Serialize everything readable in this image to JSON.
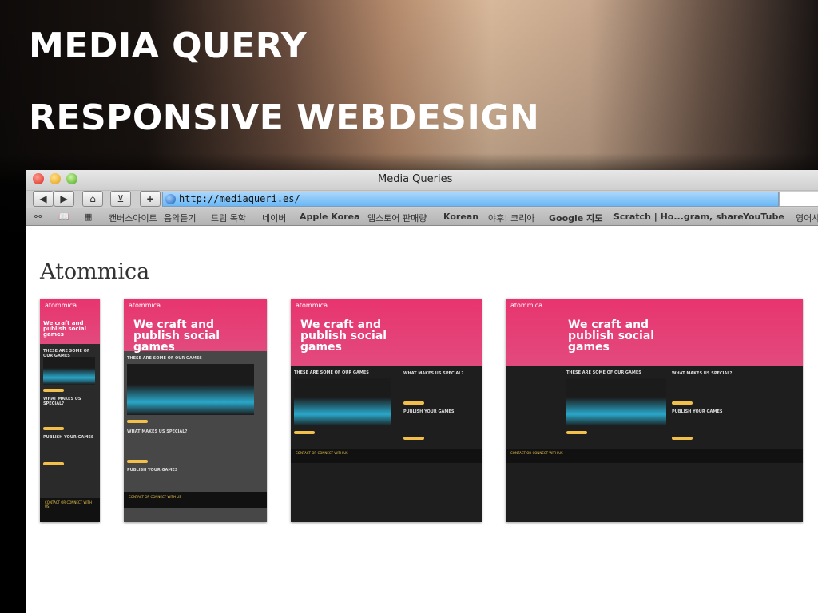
{
  "slide": {
    "title1": "MEDIA QUERY",
    "title2": "RESPONSIVE WEBDESIGN"
  },
  "browser": {
    "window_title": "Media Queries",
    "url": "http://mediaqueri.es/",
    "home_label": "⌂",
    "add_label": "+",
    "bookmarks": [
      "캔버스아이트",
      "음악듣기",
      "드럼 독학",
      "네이버",
      "Apple Korea",
      "앱스토어 판매량",
      "Korean",
      "야후! 코리아",
      "Google 지도",
      "Scratch | Ho...gram, share",
      "YouTube",
      "영어사"
    ]
  },
  "page": {
    "site_name": "Atommica"
  },
  "thumbnail": {
    "logo": "atommica",
    "headline": "We craft and publish social games",
    "games": "THESE ARE SOME OF OUR GAMES",
    "special": "WHAT MAKES US SPECIAL?",
    "publish": "PUBLISH YOUR GAMES",
    "contact": "CONTACT OR CONNECT WITH US"
  },
  "colors": {
    "accent": "#e8346f",
    "dark": "#2a2a2a",
    "button": "#f2c04a"
  }
}
